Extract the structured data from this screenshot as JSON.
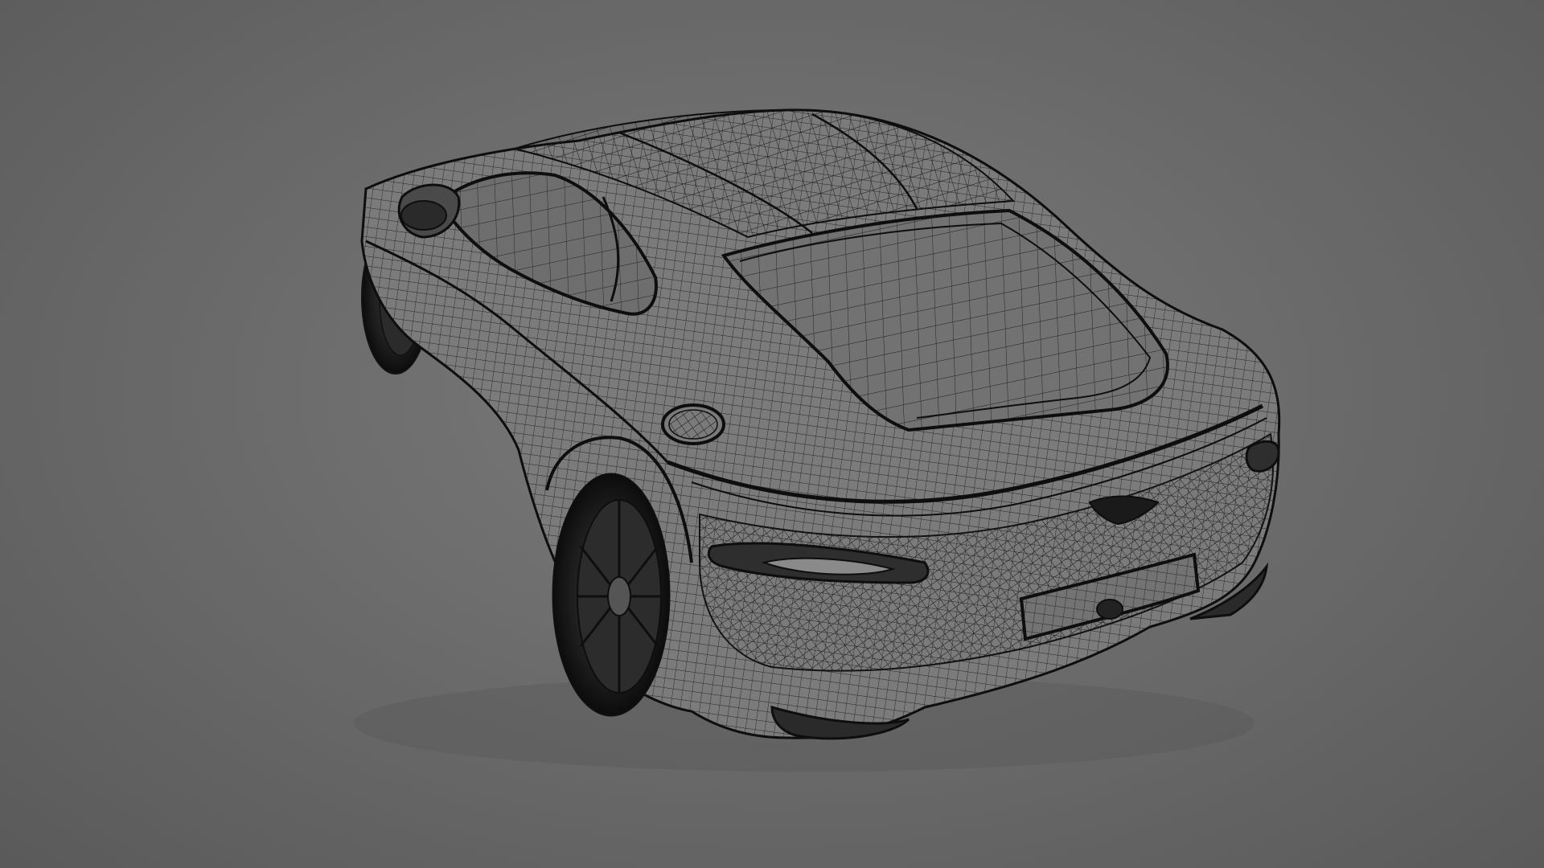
{
  "viewport": {
    "background_color": "#6b6b6b",
    "subject": "car-wireframe",
    "shading": "wireframe",
    "wire_color": "#111111",
    "surface_color": "#7a7a7a"
  }
}
